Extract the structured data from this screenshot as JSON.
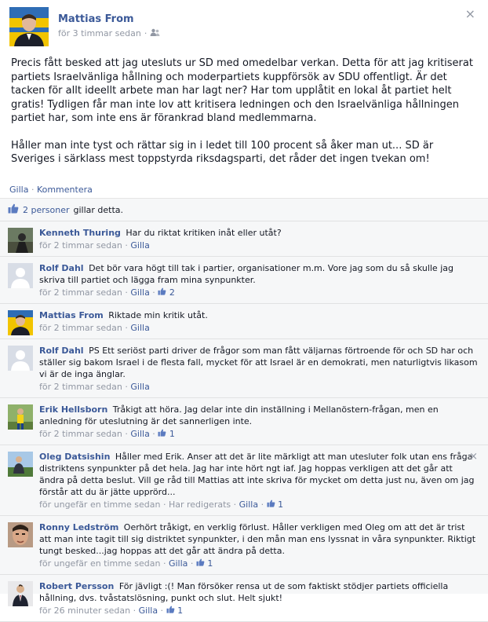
{
  "post": {
    "author": "Mattias From",
    "time": "för 3 timmar sedan",
    "close": "×",
    "paragraphs": [
      "Precis fått besked att jag utesluts ur SD med omedelbar verkan. Detta för att jag kritiserat partiets Israelvänliga hållning och moderpartiets kuppförsök av SDU offentligt. Är det tacken för allt ideellt arbete man har lagt ner? Har tom upplåtit en lokal åt partiet helt gratis! Tydligen får man inte lov att kritisera ledningen och den Israelvänliga hållningen partiet har, som inte ens är förankrad bland medlemmarna.",
      "Håller man inte tyst och rättar sig in i ledet till 100 procent så åker man ut... SD är Sveriges i särklass mest toppstyrda riksdagsparti, det råder det ingen tvekan om!"
    ],
    "actions": {
      "like": "Gilla",
      "comment": "Kommentera"
    }
  },
  "likes": {
    "link": "2 personer",
    "text": "gillar detta."
  },
  "comments": [
    {
      "name": "Kenneth Thuring",
      "text": "Har du riktat kritiken inåt eller utåt?",
      "time": "för 2 timmar sedan",
      "like": "Gilla",
      "edited": "",
      "likes": "",
      "avatar": "photo-dark"
    },
    {
      "name": "Rolf Dahl",
      "text": "Det bör vara högt till tak i partier, organisationer m.m. Vore jag som du så skulle jag skriva till partiet och lägga fram mina synpunkter.",
      "time": "för 2 timmar sedan",
      "like": "Gilla",
      "edited": "",
      "likes": "2",
      "avatar": "default"
    },
    {
      "name": "Mattias From",
      "text": "Riktade min kritik utåt.",
      "time": "för 2 timmar sedan",
      "like": "Gilla",
      "edited": "",
      "likes": "",
      "avatar": "photo-yellow"
    },
    {
      "name": "Rolf Dahl",
      "text": "PS Ett seriöst parti driver de frågor som man fått väljarnas förtroende för och SD har och ställer sig bakom Israel i de flesta fall, mycket för att Israel är en demokrati, men naturligtvis likasom vi är de inga änglar.",
      "time": "för 2 timmar sedan",
      "like": "Gilla",
      "edited": "",
      "likes": "",
      "avatar": "default"
    },
    {
      "name": "Erik Hellsborn",
      "text": "Tråkigt att höra. Jag delar inte din inställning i Mellanöstern-frågan, men en anledning för uteslutning är det sannerligen inte.",
      "time": "för 2 timmar sedan",
      "like": "Gilla",
      "edited": "",
      "likes": "1",
      "avatar": "photo-green"
    },
    {
      "name": "Oleg Datsishin",
      "text": "Håller med Erik. Anser att det är lite märkligt att man utesluter folk utan ens fråga distriktens synpunkter på det hela. Jag har inte hört ngt iaf. Jag hoppas verkligen att det går att ändra på detta beslut. Vill ge råd till Mattias att inte skriva för mycket om detta just nu, även om jag förstår att du är jätte upprörd...",
      "time": "för ungefär en timme sedan",
      "like": "Gilla",
      "edited": "Har redigerats",
      "likes": "1",
      "avatar": "photo-sky",
      "close": "×"
    },
    {
      "name": "Ronny Ledström",
      "text": "Oerhört tråkigt, en verklig förlust. Håller verkligen med Oleg om att det är trist att man inte tagit till sig distriktet synpunkter, i den mån man ens lyssnat in våra synpunkter. Riktigt tungt besked...jag hoppas att det går att ändra på detta.",
      "time": "för ungefär en timme sedan",
      "like": "Gilla",
      "edited": "",
      "likes": "1",
      "avatar": "photo-face"
    },
    {
      "name": "Robert Persson",
      "text": "För jävligt :(! Man försöker rensa ut de som faktiskt stödjer partiets officiella hållning, dvs. tvåstatslösning, punkt och slut. Helt sjukt!",
      "time": "för 26 minuter sedan",
      "like": "Gilla",
      "edited": "",
      "likes": "1",
      "avatar": "photo-suit"
    }
  ]
}
